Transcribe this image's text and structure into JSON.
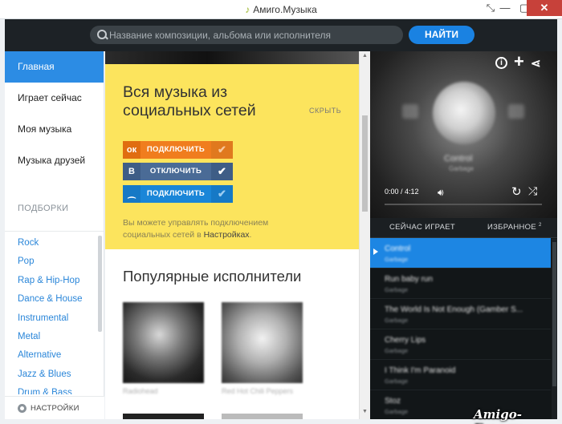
{
  "window": {
    "title": "Амиго.Музыка",
    "controls": {
      "pin": "⤡",
      "minimize": "—",
      "maximize": "▢",
      "close": "✕"
    }
  },
  "header": {
    "search_placeholder": "Название композиции, альбома или исполнителя",
    "search_value": "",
    "find_button": "НАЙТИ"
  },
  "sidebar": {
    "nav": [
      {
        "label": "Главная",
        "active": true
      },
      {
        "label": "Играет сейчас"
      },
      {
        "label": "Моя музыка"
      },
      {
        "label": "Музыка друзей"
      }
    ],
    "section_title": "ПОДБОРКИ",
    "genres": [
      "Rock",
      "Pop",
      "Rap & Hip-Hop",
      "Dance & House",
      "Instrumental",
      "Metal",
      "Alternative",
      "Jazz & Blues",
      "Drum & Bass"
    ],
    "settings_label": "НАСТРОЙКИ"
  },
  "main": {
    "social": {
      "heading": "Вся музыка из социальных сетей",
      "hide_link": "СКРЫТЬ",
      "buttons": [
        {
          "network": "odnoklassniki",
          "logo": "ок",
          "label": "ПОДКЛЮЧИТЬ",
          "connected": false,
          "color": "#f07d1e"
        },
        {
          "network": "vkontakte",
          "logo": "В",
          "label": "ОТКЛЮЧИТЬ",
          "connected": true,
          "color": "#4a6b96"
        },
        {
          "network": "mail.ru",
          "logo": "⁔",
          "label": "ПОДКЛЮЧИТЬ",
          "connected": false,
          "color": "#1a86d8"
        }
      ],
      "hint_prefix": "Вы можете управлять подключением социальных сетей в ",
      "hint_link": "Настройках",
      "hint_suffix": "."
    },
    "popular_title": "Популярные исполнители",
    "artists": [
      {
        "name": "Radiohead"
      },
      {
        "name": "Red Hot Chili Peppers"
      }
    ]
  },
  "player": {
    "time": "0:00 / 4:12",
    "current_track": "Control",
    "current_artist": "Garbage",
    "progress_fraction": 0,
    "tabs": [
      {
        "label": "СЕЙЧАС ИГРАЕТ",
        "active": true
      },
      {
        "label": "ИЗБРАННОЕ",
        "count": "2"
      }
    ],
    "playlist": [
      {
        "title": "Control",
        "artist": "Garbage",
        "active": true
      },
      {
        "title": "Run baby run",
        "artist": "Garbage"
      },
      {
        "title": "The World Is Not Enough (Gamber S...",
        "artist": "Garbage"
      },
      {
        "title": "Cherry Lips",
        "artist": "Garbage"
      },
      {
        "title": "I Think I'm Paranoid",
        "artist": "Garbage"
      },
      {
        "title": "Stoz",
        "artist": "Garbage"
      }
    ]
  },
  "watermark": "Amigo-Free.ru",
  "colors": {
    "accent": "#1a82e2",
    "yellow": "#fce45d",
    "dark": "#1d2226"
  }
}
